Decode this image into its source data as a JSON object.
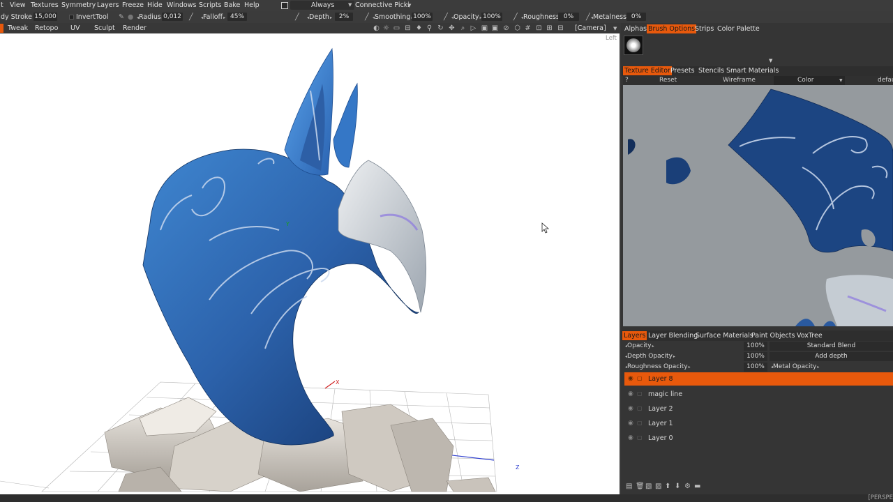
{
  "menubar": {
    "items": [
      "t",
      "View",
      "Textures",
      "Symmetry",
      "Layers",
      "Freeze",
      "Hide",
      "Windows",
      "Scripts",
      "Bake",
      "Help"
    ],
    "always_label": "Always",
    "connective_label": "Connective Picki"
  },
  "toolbar": {
    "stroke_label": "dy Stroke",
    "stroke_value": "15,000",
    "invert_label": "Invert",
    "tool_label": "Tool",
    "radius_label": "Radius",
    "radius_value": "0,012",
    "falloff_label": "Falloff",
    "falloff_value": "45%",
    "depth_label": "Depth",
    "depth_value": "2%",
    "smoothing_label": "Smoothing",
    "smoothing_value": "100%",
    "opacity_label": "Opacity",
    "opacity_value": "100%",
    "roughness_label": "Roughness",
    "roughness_value": "0%",
    "metalness_label": "Metalness",
    "metalness_value": "0%"
  },
  "rooms": [
    "Tweak",
    "Retopo",
    "UV",
    "Sculpt",
    "Render"
  ],
  "camera_label": "[Camera]",
  "viewport": {
    "corner_label": "Left",
    "axis_x": "X",
    "axis_y": "Y",
    "axis_z": "Z"
  },
  "right_panel": {
    "top_tabs": [
      "Alphas",
      "Brush Options",
      "Strips",
      "Color Palette"
    ],
    "active_top_tab": "Brush Options",
    "texture_tabs": [
      "Texture Editor",
      "Presets",
      "Stencils",
      "Smart Materials"
    ],
    "active_texture_tab": "Texture Editor",
    "texture_toolbar": {
      "help": "?",
      "reset": "Reset",
      "wireframe": "Wireframe",
      "color": "Color",
      "default": "default"
    },
    "layer_tabs": [
      "Layers",
      "Layer Blending",
      "Surface Materials",
      "Paint Objects",
      "VoxTree"
    ],
    "active_layer_tab": "Layers",
    "opacity_label": "Opacity",
    "opacity_value": "100%",
    "blend_mode": "Standard Blend",
    "depth_opacity_label": "Depth Opacity",
    "depth_opacity_value": "100%",
    "add_depth": "Add depth",
    "roughness_opacity_label": "Roughness Opacity",
    "roughness_opacity_value": "100%",
    "metal_opacity_label": "Metal Opacity",
    "layers": [
      "Layer 8",
      "magic line",
      "Layer 2",
      "Layer 1",
      "Layer 0"
    ],
    "selected_layer": "Layer 8"
  },
  "status": {
    "right_text": "[PERSPE"
  },
  "colors": {
    "accent": "#e8590c",
    "helmet_blue": "#2f6bb8",
    "panel_bg": "#353535"
  }
}
